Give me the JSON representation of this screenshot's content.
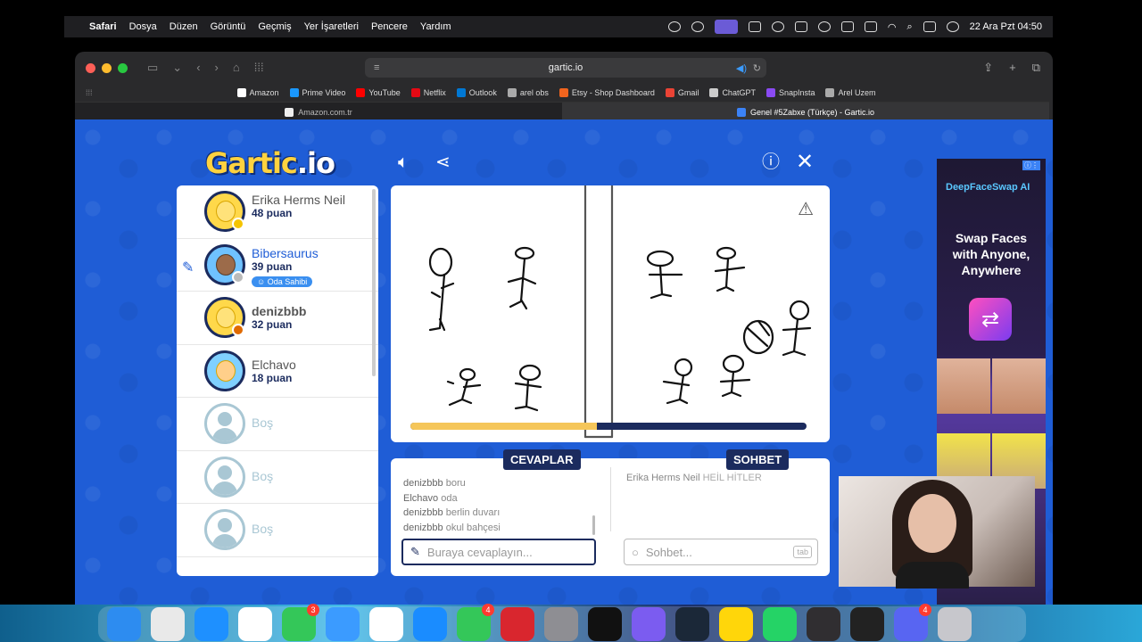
{
  "menubar": {
    "app_name": "Safari",
    "menus": [
      "Dosya",
      "Düzen",
      "Görüntü",
      "Geçmiş",
      "Yer İşaretleri",
      "Pencere",
      "Yardım"
    ],
    "datetime": "22 Ara Pzt  04:50"
  },
  "browser": {
    "url": "gartic.io",
    "favorites": [
      {
        "label": "Amazon",
        "color": "#ffffff"
      },
      {
        "label": "Prime Video",
        "color": "#1a98ff"
      },
      {
        "label": "YouTube",
        "color": "#ff0000"
      },
      {
        "label": "Netflix",
        "color": "#e50914"
      },
      {
        "label": "Outlook",
        "color": "#0078d4"
      },
      {
        "label": "arel obs",
        "color": "#aaaaaa"
      },
      {
        "label": "Etsy - Shop Dashboard",
        "color": "#f1641e"
      },
      {
        "label": "Gmail",
        "color": "#ea4335"
      },
      {
        "label": "ChatGPT",
        "color": "#cccccc"
      },
      {
        "label": "SnapInsta",
        "color": "#8a4af3"
      },
      {
        "label": "Arel Uzem",
        "color": "#aaaaaa"
      }
    ],
    "tabs": [
      {
        "label": "Amazon.com.tr",
        "active": false
      },
      {
        "label": "Genel #5Zabxe (Türkçe) - Gartic.io",
        "active": true
      }
    ]
  },
  "game": {
    "logo_main": "Gartic",
    "logo_sub": ".io",
    "players": [
      {
        "name": "Erika Herms Neil",
        "score": "48 puan",
        "dot": "#f5c400",
        "avatar": "smile",
        "me": false
      },
      {
        "name": "Bibersaurus",
        "score": "39 puan",
        "dot": "#bbbbbb",
        "avatar": "dark",
        "me": true,
        "badge": "Oda Sahibi"
      },
      {
        "name": "denizbbb",
        "score": "32 puan",
        "dot": "#e06a00",
        "avatar": "smile",
        "me": false
      },
      {
        "name": "Elchavo",
        "score": "18 puan",
        "dot": "",
        "avatar": "cap",
        "me": false
      }
    ],
    "empty_slot_label": "Boş",
    "progress": 0.47,
    "answers_tag": "CEVAPLAR",
    "chat_tag": "SOHBET",
    "answers": [
      {
        "who": "denizbbb",
        "text": "boru"
      },
      {
        "who": "Elchavo",
        "text": "oda"
      },
      {
        "who": "denizbbb",
        "text": "berlin duvarı"
      },
      {
        "who": "denizbbb",
        "text": "okul bahçesi"
      }
    ],
    "chat": [
      {
        "who": "Erika Herms Neil",
        "text": "HEİL HİTLER"
      }
    ],
    "answer_placeholder": "Buraya cevaplayın...",
    "chat_placeholder": "Sohbet...",
    "chat_key": "tab"
  },
  "ad": {
    "title": "DeepFaceSwap AI",
    "text": "Swap Faces with Anyone, Anywhere"
  },
  "dock": {
    "apps": [
      {
        "name": "finder",
        "color": "#2d8cf0",
        "badge": ""
      },
      {
        "name": "launchpad",
        "color": "#e9e9e9",
        "badge": ""
      },
      {
        "name": "safari",
        "color": "#1e90ff",
        "badge": ""
      },
      {
        "name": "chrome",
        "color": "#ffffff",
        "badge": ""
      },
      {
        "name": "messages",
        "color": "#34c759",
        "badge": "3"
      },
      {
        "name": "mail",
        "color": "#3b9bff",
        "badge": ""
      },
      {
        "name": "photos",
        "color": "#ffffff",
        "badge": ""
      },
      {
        "name": "app-store",
        "color": "#1a8cff",
        "badge": ""
      },
      {
        "name": "facetime",
        "color": "#34c759",
        "badge": "4"
      },
      {
        "name": "photo-booth",
        "color": "#d9262e",
        "badge": ""
      },
      {
        "name": "system-settings",
        "color": "#8e8e93",
        "badge": ""
      },
      {
        "name": "spotify",
        "color": "#111111",
        "badge": ""
      },
      {
        "name": "infuse",
        "color": "#7b5cf0",
        "badge": ""
      },
      {
        "name": "steam",
        "color": "#1b2838",
        "badge": ""
      },
      {
        "name": "notes",
        "color": "#ffd60a",
        "badge": ""
      },
      {
        "name": "whatsapp",
        "color": "#25d366",
        "badge": ""
      },
      {
        "name": "obs",
        "color": "#302e31",
        "badge": ""
      },
      {
        "name": "activity-monitor",
        "color": "#222222",
        "badge": ""
      },
      {
        "name": "discord",
        "color": "#5865f2",
        "badge": "4"
      },
      {
        "name": "trash",
        "color": "#c7c7cc",
        "badge": ""
      }
    ]
  }
}
